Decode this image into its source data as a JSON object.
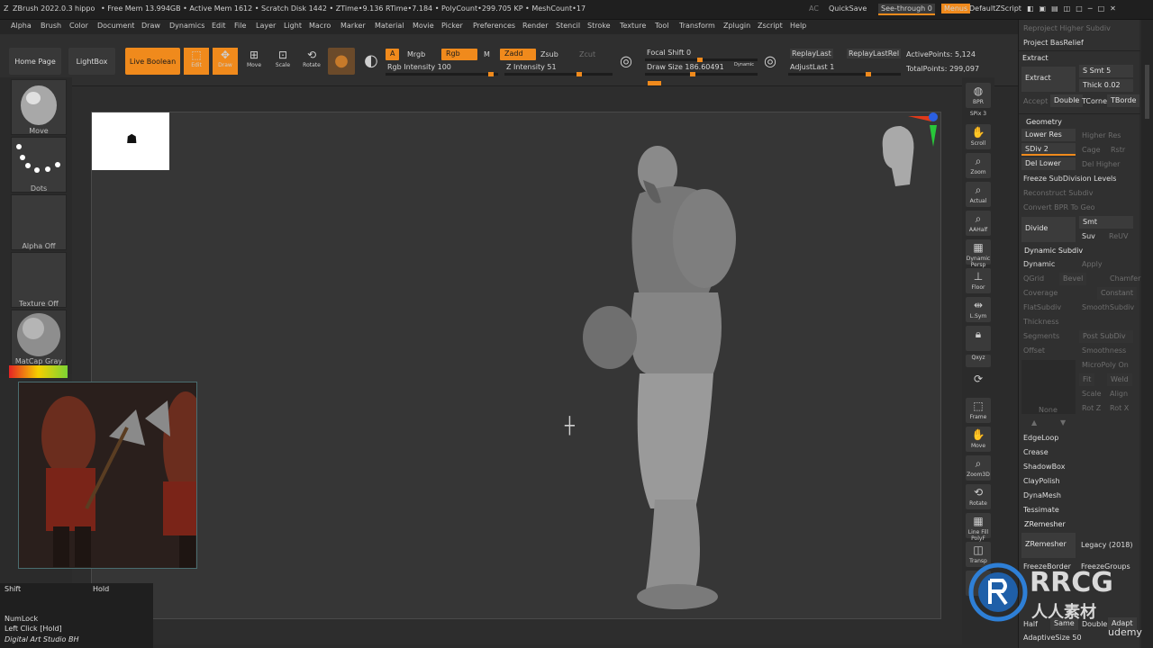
{
  "titlebar": {
    "app": "ZBrush 2022.0.3",
    "user": "hippo",
    "stats": "• Free Mem 13.994GB • Active Mem 1612 • Scratch Disk 1442 • ZTime•9.136 RTime•7.184 • PolyCount•299.705 KP • MeshCount•17",
    "ac": "AC",
    "quicksave": "QuickSave",
    "seethrough": "See-through  0",
    "menus": "Menus",
    "script": "DefaultZScript"
  },
  "menubar": [
    "Alpha",
    "Brush",
    "Color",
    "Document",
    "Draw",
    "Dynamics",
    "Edit",
    "File",
    "Layer",
    "Light",
    "Macro",
    "Marker",
    "Material",
    "Movie",
    "Picker",
    "Preferences",
    "Render",
    "Stencil",
    "Stroke",
    "Texture",
    "Tool",
    "Transform",
    "Zplugin",
    "Zscript",
    "Help"
  ],
  "shelf": {
    "home": "Home Page",
    "lightbox": "LightBox",
    "live_boolean": "Live Boolean",
    "edit": "Edit",
    "draw": "Draw",
    "move": "Move",
    "scale": "Scale",
    "rotate": "Rotate",
    "a": "A",
    "mrgb": "Mrgb",
    "rgb": "Rgb",
    "m": "M",
    "zadd": "Zadd",
    "zsub": "Zsub",
    "zcut": "Zcut",
    "rgb_intensity": "Rgb Intensity 100",
    "z_intensity": "Z Intensity 51",
    "focal_shift": "Focal Shift 0",
    "draw_size": "Draw Size 186.60491",
    "dynamic": "Dynamic",
    "replay_last": "ReplayLast",
    "replay_last_rel": "ReplayLastRel",
    "adjust_last": "AdjustLast 1",
    "active_points": "ActivePoints: 5,124",
    "total_points": "TotalPoints: 299,097"
  },
  "left_tray": {
    "brush": "Move",
    "stroke": "Dots",
    "alpha": "Alpha Off",
    "texture": "Texture Off",
    "material": "MatCap Gray"
  },
  "right_shelf": [
    "BPR",
    "SPix 3",
    "Scroll",
    "Zoom",
    "Actual",
    "AAHalf",
    "Dynamic Persp",
    "Floor",
    "L.Sym",
    "Lock",
    "Qxyz",
    "Frame",
    "Move",
    "Zoom3D",
    "Rotate",
    "Line Fill PolyF",
    "Transp"
  ],
  "palette": {
    "reproject": "Reproject Higher Subdiv",
    "project_basrelief": "Project BasRelief",
    "extract_head": "Extract",
    "extract_btn": "Extract",
    "s_smt": "S Smt 5",
    "thick": "Thick 0.02",
    "accept": "Accept",
    "double": "Double",
    "tcorne": "TCorne",
    "tborde": "TBorde",
    "geometry": "Geometry",
    "lower_res": "Lower Res",
    "higher_res": "Higher Res",
    "sdiv": "SDiv 2",
    "cage": "Cage",
    "rstr": "Rstr",
    "del_lower": "Del Lower",
    "del_higher": "Del Higher",
    "freeze": "Freeze SubDivision Levels",
    "reconstruct": "Reconstruct Subdiv",
    "convert_bpr": "Convert BPR To Geo",
    "divide": "Divide",
    "smt": "Smt",
    "suv": "Suv",
    "reuv": "ReUV",
    "dyn_subdiv": "Dynamic Subdiv",
    "dynamic": "Dynamic",
    "apply": "Apply",
    "qgrid": "QGrid",
    "bevel": "Bevel",
    "chamfer": "Chamfer",
    "coverage": "Coverage",
    "constant": "Constant",
    "flatsubdiv": "FlatSubdiv",
    "smoothsubdiv": "SmoothSubdiv",
    "thickness": "Thickness",
    "segments": "Segments",
    "post_subdiv": "Post SubDiv",
    "offset": "Offset",
    "smoothness": "Smoothness",
    "micropoly": "MicroPoly On",
    "fit": "Fit",
    "weld": "Weld",
    "scale": "Scale",
    "align": "Align",
    "none": "None",
    "rotz": "Rot Z",
    "rotx": "Rot X",
    "edgeloop": "EdgeLoop",
    "crease": "Crease",
    "shadowbox": "ShadowBox",
    "claypolish": "ClayPolish",
    "dynamesh": "DynaMesh",
    "tessimate": "Tessimate",
    "zremesher_head": "ZRemesher",
    "zremesher_btn": "ZRemesher",
    "legacy": "Legacy (2018)",
    "freezeborder": "FreezeBorder",
    "freezegroups": "FreezeGroups",
    "half": "Half",
    "same": "Same",
    "double2": "Double",
    "adapt": "Adapt",
    "adaptive_size": "AdaptiveSize 50"
  },
  "hotkeys": {
    "shift": "Shift",
    "hold": "Hold",
    "numlock": "NumLock",
    "leftclick": "Left Click [Hold]",
    "studio": "Digital Art Studio BH"
  },
  "watermark": {
    "brand": "RRCG",
    "sub": "人人素材",
    "udemy": "udemy"
  },
  "colors": {
    "accent": "#f08a1c",
    "panel": "#303030",
    "canvas": "#363636"
  }
}
